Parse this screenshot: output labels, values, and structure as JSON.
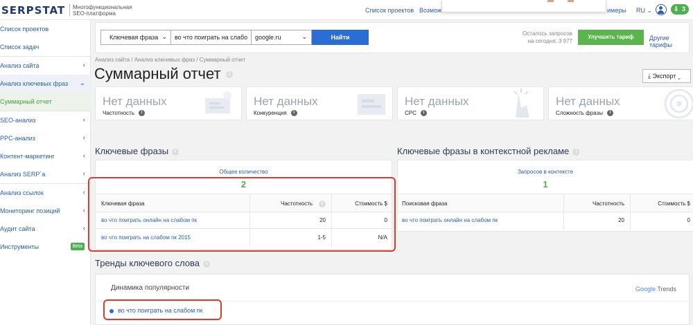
{
  "header": {
    "logo": "SERPSTAT",
    "tagline_line1": "Многофункциональная",
    "tagline_line2": "SEO-платформа",
    "nav_projects": "Список проектов",
    "nav_features": "Возмож",
    "nav_examples": "имеры",
    "lang": "RU",
    "downloads_count": "3"
  },
  "sidebar": {
    "items": [
      {
        "label": "Список проектов"
      },
      {
        "label": "Список задач"
      },
      {
        "label": "Анализ сайта"
      },
      {
        "label": "Анализ ключевых фраз"
      },
      {
        "label": "Суммарный отчет"
      },
      {
        "label": "SEO-анализ"
      },
      {
        "label": "PPC-анализ"
      },
      {
        "label": "Контент-маркетинг"
      },
      {
        "label": "Анализ SERP`a"
      },
      {
        "label": "Анализ ссылок"
      },
      {
        "label": "Мониторинг позиций"
      },
      {
        "label": "Аудит сайта"
      },
      {
        "label": "Инструменты"
      }
    ],
    "beta": "Beta"
  },
  "search": {
    "type_label": "Ключевая фраза",
    "query": "во что поиграть на слабо",
    "database": "google.ru",
    "go_label": "Найти",
    "limits_line1": "Осталось запросов",
    "limits_line2": "на сегодня: 3 977",
    "upgrade_label": "Улучшить тариф",
    "other_plans": "Другие тарифы"
  },
  "breadcrumb": "Анализ сайта / Анализ ключевых фраз / Суммарный отчет",
  "page_title": "Суммарный отчет",
  "export_label": "Экспорт",
  "stats": [
    {
      "value": "Нет данных",
      "label": "Частотность"
    },
    {
      "value": "Нет данных",
      "label": "Конкуренция"
    },
    {
      "value": "Нет данных",
      "label": "CPC"
    },
    {
      "value": "Нет данных",
      "label": "Сложность фразы"
    }
  ],
  "keywords": {
    "title": "Ключевые фразы",
    "total_label": "Общее количество",
    "total_value": "2",
    "columns": [
      "Ключевая фраза",
      "Частотность",
      "Стоимость $"
    ],
    "rows": [
      {
        "phrase": "во что поиграть онлайн на слабом пк",
        "freq": "20",
        "cost": "0"
      },
      {
        "phrase": "во что поиграть на слабом пк 2015",
        "freq": "1-5",
        "cost": "N/A"
      }
    ]
  },
  "ads": {
    "title": "Ключевые фразы в контекстной рекламе",
    "total_label": "Запросов в контексте",
    "total_value": "1",
    "columns": [
      "Поисковая фраза",
      "Частотность",
      "Стоимость $"
    ],
    "rows": [
      {
        "phrase": "во что поиграть онлайн на слабом пк",
        "freq": "20",
        "cost": "0"
      }
    ]
  },
  "trends": {
    "title": "Тренды ключевого слова",
    "subtitle": "Динамика популярности",
    "brand_google": "Google",
    "brand_trends": "Trends",
    "legend": "во что поиграть на слабом пк"
  },
  "colors": {
    "accent": "#2a6ed5",
    "success": "#4caf50",
    "highlight": "#e03a2e"
  }
}
